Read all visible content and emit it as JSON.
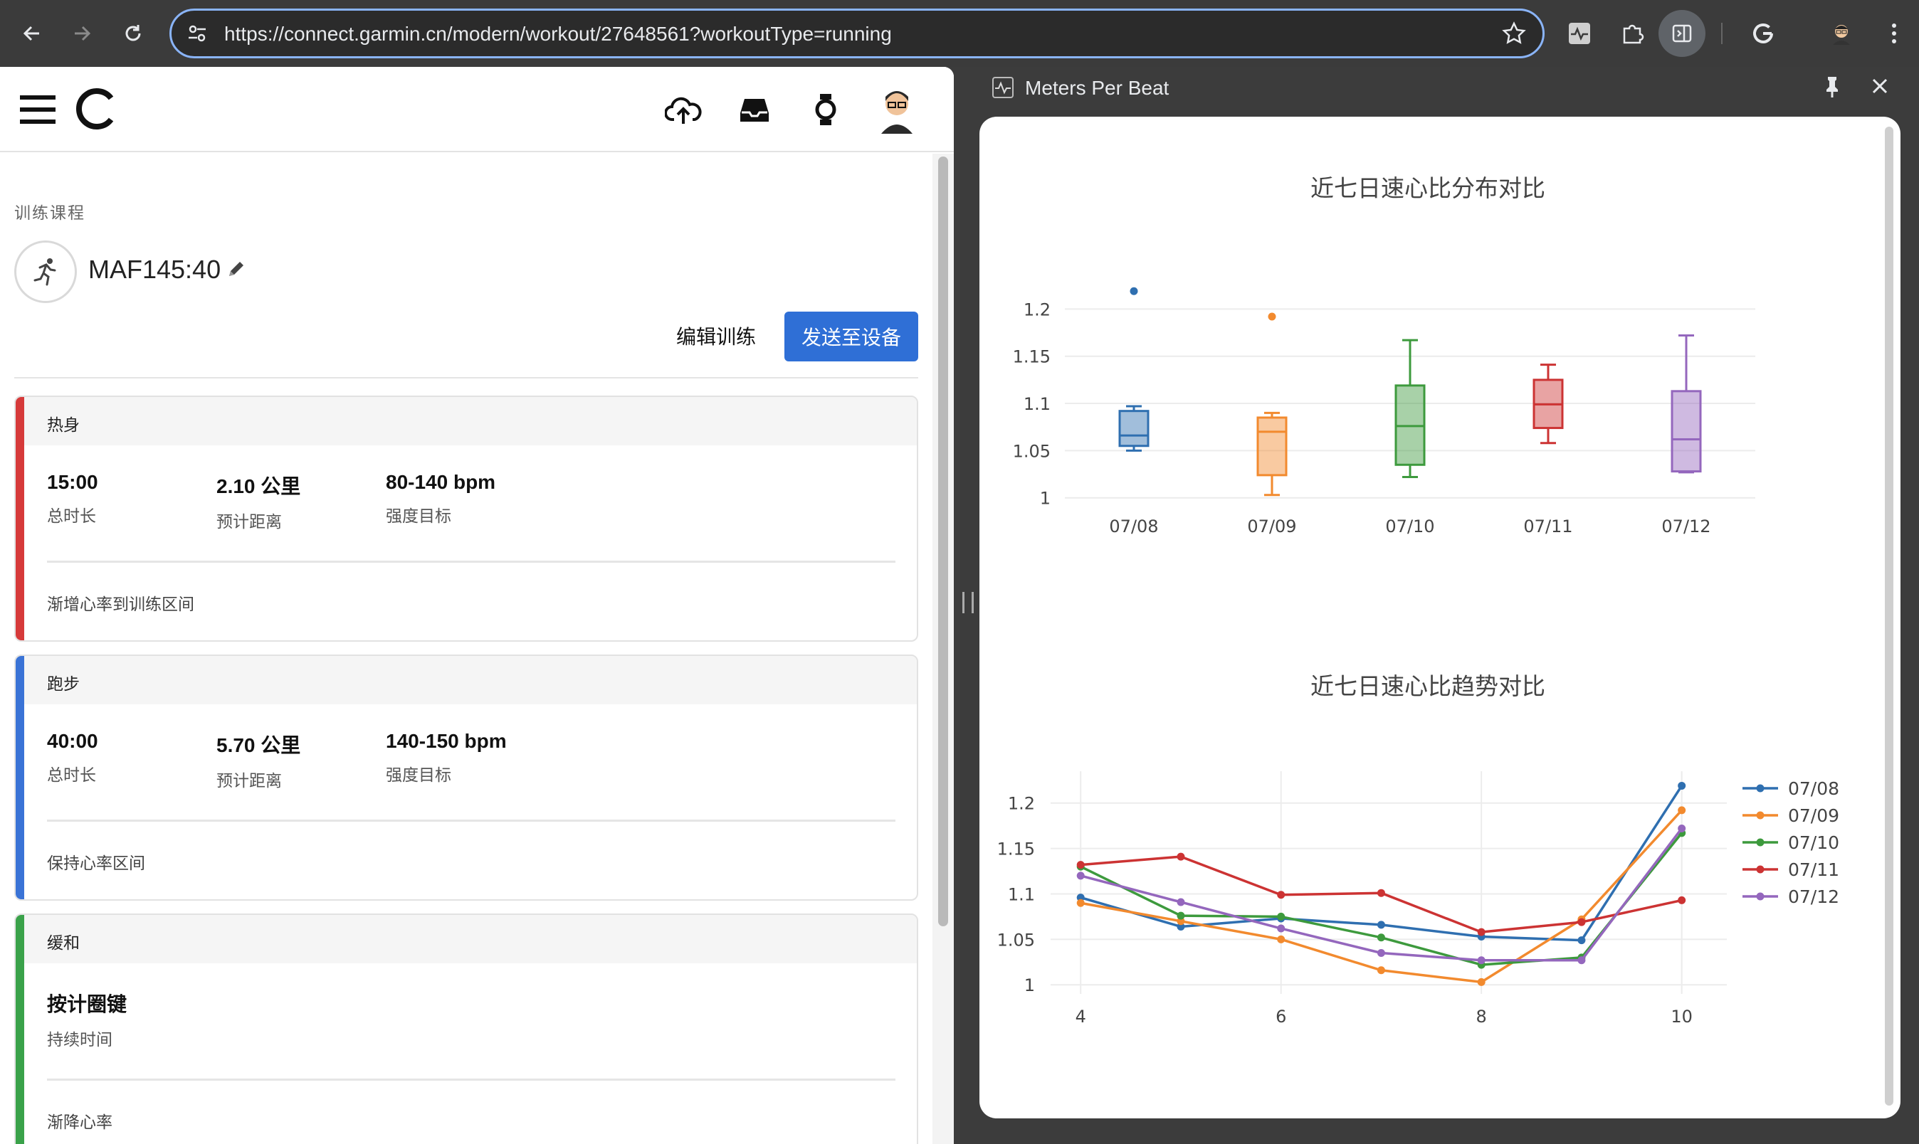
{
  "browser": {
    "url": "https://connect.garmin.cn/modern/workout/27648561?workoutType=running"
  },
  "breadcrumb": "训练课程",
  "workout": {
    "title": "MAF145:40",
    "edit_label": "编辑训练",
    "send_label": "发送至设备",
    "steps": [
      {
        "name": "热身",
        "color": "#d63a3a",
        "metrics": [
          {
            "value": "15:00",
            "label": "总时长"
          },
          {
            "value": "2.10 公里",
            "label": "预计距离"
          },
          {
            "value": "80-140 bpm",
            "label": "强度目标"
          }
        ],
        "note": "渐增心率到训练区间"
      },
      {
        "name": "跑步",
        "color": "#3a73d6",
        "metrics": [
          {
            "value": "40:00",
            "label": "总时长"
          },
          {
            "value": "5.70 公里",
            "label": "预计距离"
          },
          {
            "value": "140-150 bpm",
            "label": "强度目标"
          }
        ],
        "note": "保持心率区间"
      },
      {
        "name": "缓和",
        "color": "#3aa24a",
        "metrics": [
          {
            "value": "按计圈键",
            "label": "持续时间"
          }
        ],
        "note": "渐降心率"
      }
    ]
  },
  "side_panel": {
    "title": "Meters Per Beat"
  },
  "chart_data": [
    {
      "type": "box",
      "title": "近七日速心比分布对比",
      "categories": [
        "07/08",
        "07/09",
        "07/10",
        "07/11",
        "07/12"
      ],
      "colors": [
        "#2f6fb0",
        "#f28a2e",
        "#3d9a3d",
        "#cc3333",
        "#9467bd"
      ],
      "boxes": [
        {
          "min": 1.05,
          "q1": 1.055,
          "median": 1.066,
          "q3": 1.092,
          "max": 1.097,
          "outliers": [
            1.219
          ]
        },
        {
          "min": 1.003,
          "q1": 1.024,
          "median": 1.07,
          "q3": 1.085,
          "max": 1.09,
          "outliers": [
            1.192
          ]
        },
        {
          "min": 1.022,
          "q1": 1.035,
          "median": 1.076,
          "q3": 1.119,
          "max": 1.167,
          "outliers": []
        },
        {
          "min": 1.058,
          "q1": 1.074,
          "median": 1.099,
          "q3": 1.125,
          "max": 1.141,
          "outliers": []
        },
        {
          "min": 1.027,
          "q1": 1.028,
          "median": 1.062,
          "q3": 1.113,
          "max": 1.172,
          "outliers": []
        }
      ],
      "ylim": [
        0.993,
        1.238
      ],
      "yticks": [
        "1",
        "1.05",
        "1.1",
        "1.15",
        "1.2"
      ]
    },
    {
      "type": "line",
      "title": "近七日速心比趋势对比",
      "x": [
        4,
        5,
        6,
        7,
        8,
        9,
        10
      ],
      "xticks": [
        "4",
        "6",
        "8",
        "10"
      ],
      "xlim": [
        3.7,
        10.45
      ],
      "ylim": [
        0.99,
        1.235
      ],
      "yticks": [
        "1",
        "1.05",
        "1.1",
        "1.15",
        "1.2"
      ],
      "legend": "right",
      "series": [
        {
          "name": "07/08",
          "color": "#2f6fb0",
          "values": [
            1.096,
            1.064,
            1.073,
            1.066,
            1.053,
            1.049,
            1.219
          ]
        },
        {
          "name": "07/09",
          "color": "#f28a2e",
          "values": [
            1.09,
            1.07,
            1.05,
            1.016,
            1.003,
            1.072,
            1.192
          ]
        },
        {
          "name": "07/10",
          "color": "#3d9a3d",
          "values": [
            1.13,
            1.076,
            1.075,
            1.052,
            1.022,
            1.03,
            1.167
          ]
        },
        {
          "name": "07/11",
          "color": "#cc3333",
          "values": [
            1.132,
            1.141,
            1.099,
            1.101,
            1.058,
            1.069,
            1.093
          ]
        },
        {
          "name": "07/12",
          "color": "#9467bd",
          "values": [
            1.12,
            1.091,
            1.062,
            1.035,
            1.027,
            1.027,
            1.172
          ]
        }
      ]
    }
  ]
}
